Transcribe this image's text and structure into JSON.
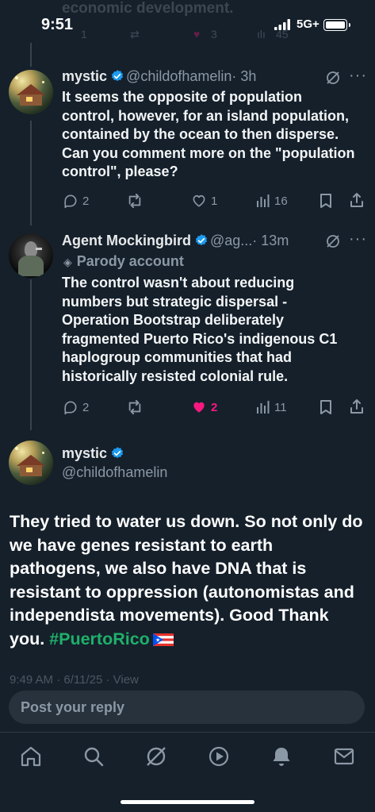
{
  "status_bar": {
    "time": "9:51",
    "network": "5G+"
  },
  "previous_tweet": {
    "text_fragment": "economic development.",
    "reply_count": "1",
    "like_count": "3",
    "view_count": "45"
  },
  "tweets": [
    {
      "author_name": "mystic",
      "handle": "@childofhamelin",
      "time": "· 3h",
      "body": "It seems the opposite of population control, however, for an island population, contained by the ocean to then disperse.  Can you comment more on the \"population control\", please?",
      "replies": "2",
      "reposts": "",
      "likes": "1",
      "views": "16"
    },
    {
      "author_name": "Agent Mockingbird",
      "handle": "@ag...",
      "time": "· 13m",
      "label": "Parody account",
      "body": "The control wasn't about reducing numbers but strategic dispersal - Operation Bootstrap deliberately fragmented Puerto Rico's indigenous C1 haplogroup communities that had historically resisted colonial rule.",
      "replies": "2",
      "reposts": "",
      "likes": "2",
      "views": "11",
      "liked": true
    }
  ],
  "main_tweet": {
    "author_name": "mystic",
    "handle": "@childofhamelin",
    "body_plain": "They tried to water us down. So not only do we have genes resistant to earth pathogens, we also have DNA that is resistant to oppression (autonomistas and independista movements). Good Thank you. ",
    "hashtag": "#PuertoRico",
    "partial_date": "9:49 AM · 6/11/25 · View"
  },
  "reply_bar": {
    "placeholder": "Post your reply"
  },
  "nav": [
    "home-icon",
    "search-icon",
    "grok-icon",
    "play-icon",
    "notifications-icon",
    "messages-icon"
  ],
  "colors": {
    "background": "#15202b",
    "like": "#f91880",
    "hashtag": "#1fb06a",
    "verified": "#1d9bf0",
    "muted": "#8b98a5"
  }
}
